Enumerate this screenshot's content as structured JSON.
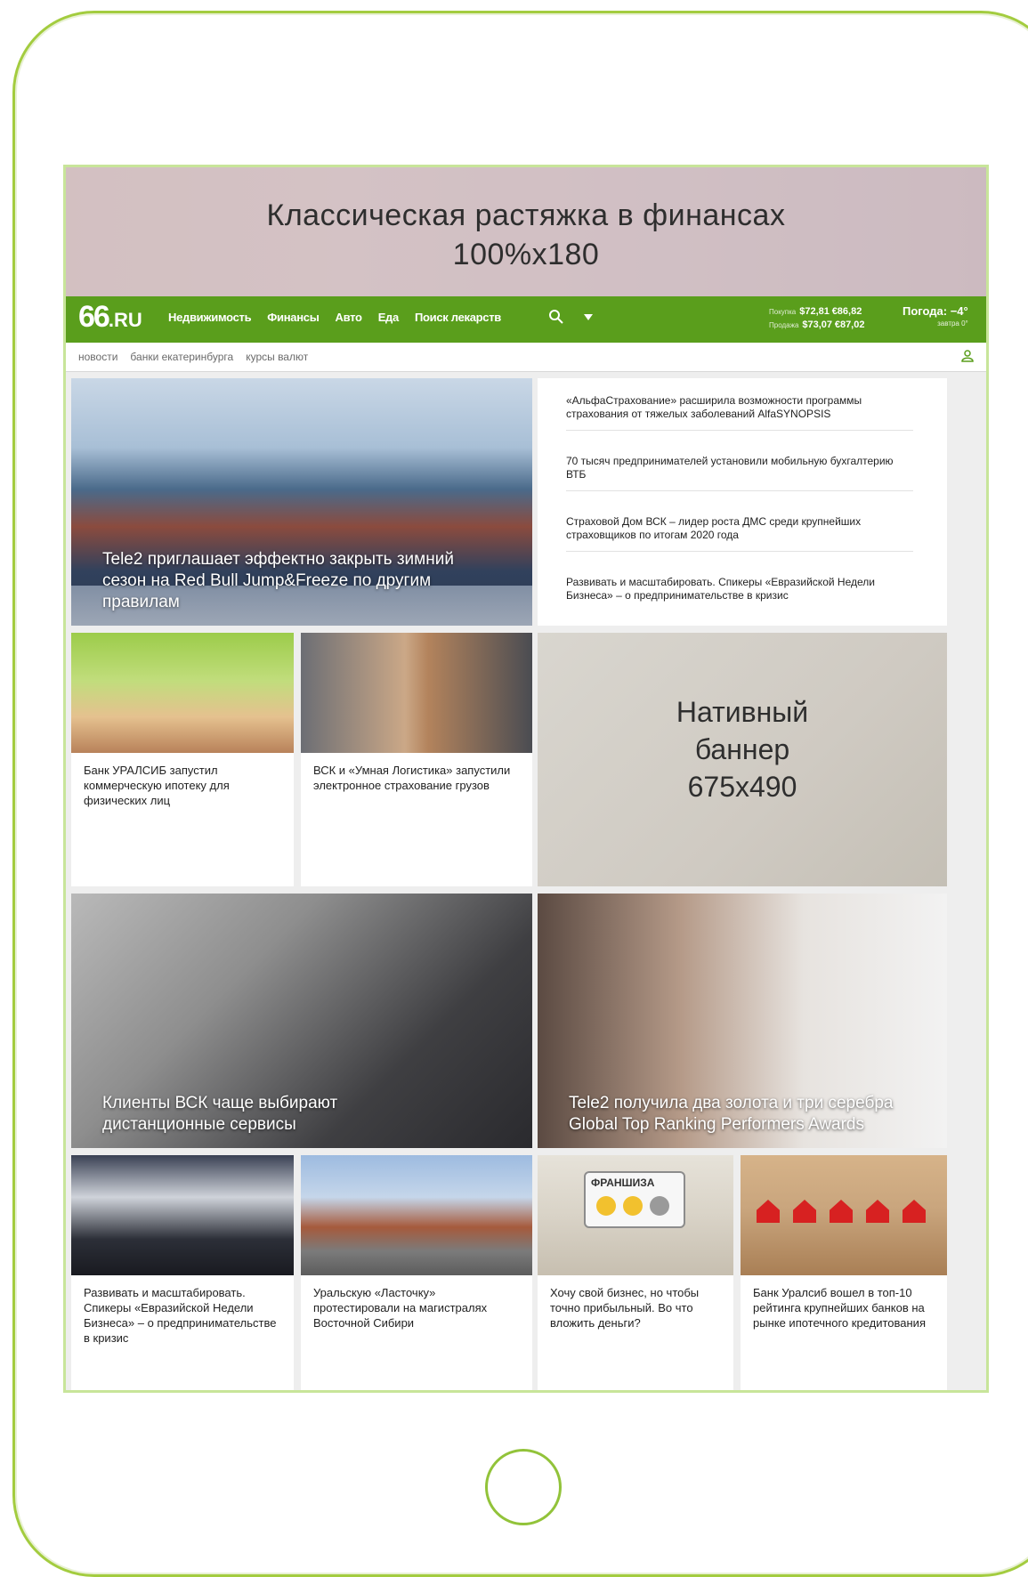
{
  "banner": {
    "line1": "Классическая растяжка в финансах",
    "line2": "100%x180"
  },
  "header": {
    "logo_main": "66",
    "logo_suffix": ".RU",
    "nav": [
      "Недвижимость",
      "Финансы",
      "Авто",
      "Еда",
      "Поиск лекарств"
    ],
    "rates": {
      "buy_label": "Покупка",
      "buy_usd": "$72,81",
      "buy_eur": "€86,82",
      "sell_label": "Продажа",
      "sell_usd": "$73,07",
      "sell_eur": "€87,02"
    },
    "weather": {
      "label": "Погода: −4°",
      "tomorrow": "завтра 0°"
    }
  },
  "subnav": [
    "новости",
    "банки екатеринбурга",
    "курсы валют"
  ],
  "hero": {
    "title": "Tele2 приглашает эффектно закрыть зимний сезон на Red Bull Jump&Freeze по другим правилам"
  },
  "news": [
    "«АльфаСтрахование» расширила возможности программы страхования от тяжелых заболеваний AlfaSYNOPSIS",
    "70 тысяч предпринимателей установили мобильную бухгалтерию ВТБ",
    "Страховой Дом ВСК – лидер роста ДМС среди крупнейших страховщиков по итогам 2020 года",
    "Развивать и масштабировать. Спикеры «Евразийской Недели Бизнеса» – о предпринимательстве в кризис"
  ],
  "cards_row1": [
    "Банк УРАЛСИБ запустил коммерческую ипотеку для физических лиц",
    "ВСК и «Умная Логистика» запустили электронное страхование грузов"
  ],
  "native": {
    "line1": "Нативный",
    "line2": "баннер",
    "line3": "675x490"
  },
  "big_tiles": [
    "Клиенты ВСК чаще выбирают дистанционные сервисы",
    "Tele2 получила два золота и три серебра Global Top Ranking Performers Awards"
  ],
  "cards_row3": [
    "Развивать и масштабировать. Спикеры «Евразийской Недели Бизнеса» – о предпринимательстве в кризис",
    "Уральскую «Ласточку» протестировали на магистралях Восточной Сибири",
    "Хочу свой бизнес, но чтобы точно прибыльный. Во что вложить деньги?",
    "Банк Уралсиб вошел в топ-10 рейтинга крупнейших банков на рынке ипотечного кредитования"
  ],
  "franchise_sign": "ФРАНШИЗА",
  "colors": {
    "brand_green": "#5a9e1c",
    "frame": "#a3cc3f"
  }
}
